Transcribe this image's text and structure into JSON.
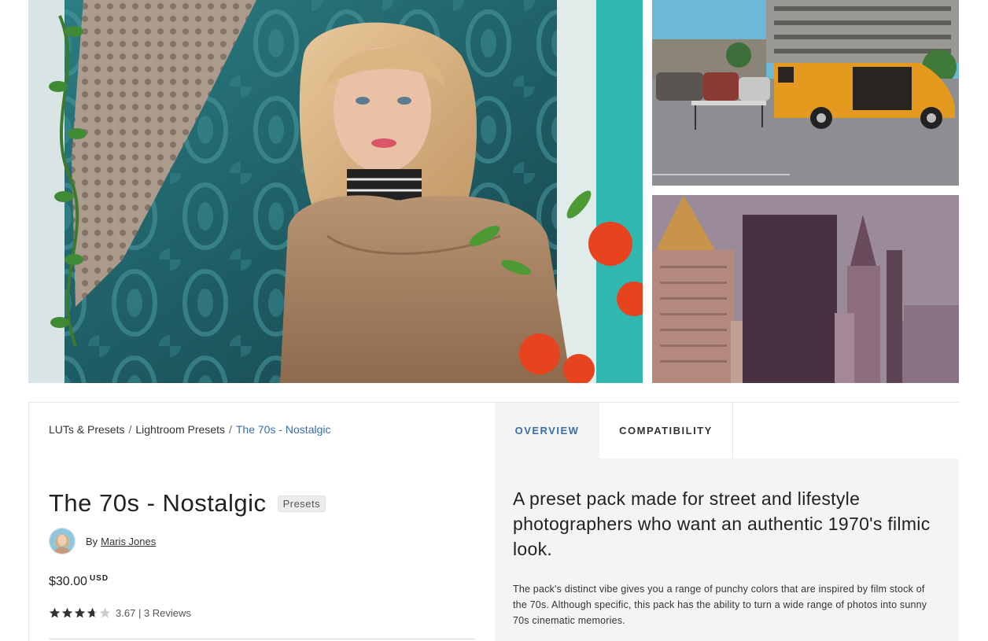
{
  "gallery": {
    "main_image": "woman-portrait-photo",
    "top_right_image": "orange-van-parking-lot-photo",
    "bottom_right_image": "city-skyline-photo"
  },
  "breadcrumb": {
    "items": [
      "LUTs & Presets",
      "Lightroom Presets",
      "The 70s - Nostalgic"
    ],
    "separator": "/"
  },
  "product": {
    "title": "The 70s - Nostalgic",
    "badge": "Presets",
    "by_label": "By",
    "author": "Maris Jones",
    "price": "$30.00",
    "currency": "USD",
    "rating_value": 3.67,
    "rating_text": "3.67",
    "reviews_text": "| 3 Reviews"
  },
  "tabs": [
    {
      "label": "OVERVIEW",
      "active": true
    },
    {
      "label": "COMPATIBILITY",
      "active": false
    }
  ],
  "overview": {
    "lead": "A preset pack made for street and lifestyle photographers who want an authentic 1970's filmic look.",
    "body": "The pack's distinct vibe gives you a range of punchy colors that are inspired by film stock of the 70s. Although specific, this pack has the ability to turn a wide range of photos into sunny 70s cinematic memories."
  },
  "colors": {
    "accent": "#3a6ea5",
    "panel_bg": "#f4f4f4",
    "star": "#333333",
    "star_empty": "#cccccc"
  }
}
